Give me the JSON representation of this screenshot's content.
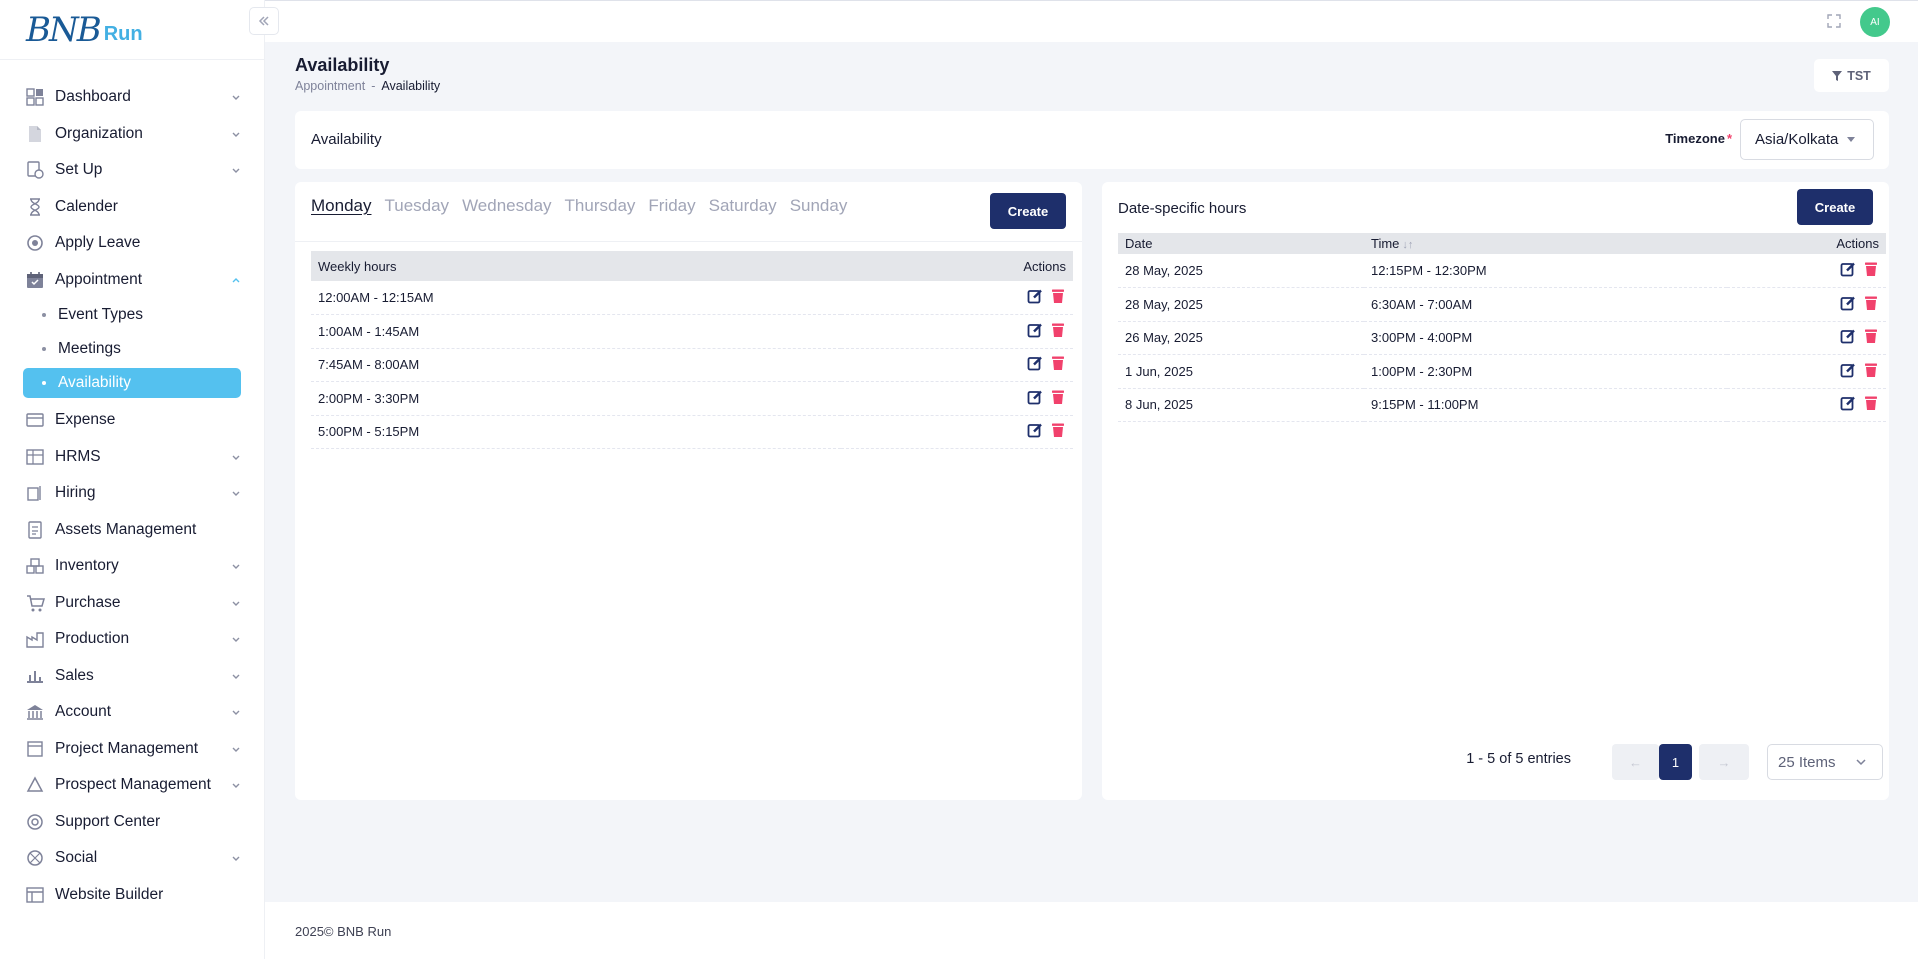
{
  "brand": {
    "logo_text": "BNB",
    "logo_suffix": "Run"
  },
  "sidebar": {
    "items": [
      {
        "label": "Dashboard",
        "icon": "dashboard-icon",
        "expandable": true
      },
      {
        "label": "Organization",
        "icon": "organization-icon",
        "expandable": true
      },
      {
        "label": "Set Up",
        "icon": "setup-icon",
        "expandable": true
      },
      {
        "label": "Calender",
        "icon": "hourglass-icon",
        "expandable": false
      },
      {
        "label": "Apply Leave",
        "icon": "leave-icon",
        "expandable": false
      },
      {
        "label": "Appointment",
        "icon": "calendar-icon",
        "expandable": true,
        "expanded": true
      },
      {
        "label": "Expense",
        "icon": "expense-icon",
        "expandable": false
      },
      {
        "label": "HRMS",
        "icon": "hrms-icon",
        "expandable": true
      },
      {
        "label": "Hiring",
        "icon": "hiring-icon",
        "expandable": true
      },
      {
        "label": "Assets Management",
        "icon": "assets-icon",
        "expandable": false
      },
      {
        "label": "Inventory",
        "icon": "inventory-icon",
        "expandable": true
      },
      {
        "label": "Purchase",
        "icon": "cart-icon",
        "expandable": true
      },
      {
        "label": "Production",
        "icon": "factory-icon",
        "expandable": true
      },
      {
        "label": "Sales",
        "icon": "sales-icon",
        "expandable": true
      },
      {
        "label": "Account",
        "icon": "bank-icon",
        "expandable": true
      },
      {
        "label": "Project Management",
        "icon": "project-icon",
        "expandable": true
      },
      {
        "label": "Prospect Management",
        "icon": "prospect-icon",
        "expandable": true
      },
      {
        "label": "Support Center",
        "icon": "support-icon",
        "expandable": false
      },
      {
        "label": "Social",
        "icon": "social-icon",
        "expandable": true
      },
      {
        "label": "Website Builder",
        "icon": "website-icon",
        "expandable": false
      }
    ],
    "appointment_sub": [
      "Event Types",
      "Meetings",
      "Availability"
    ]
  },
  "topbar": {
    "avatar_initials": "AI"
  },
  "page": {
    "title": "Availability",
    "breadcrumb": [
      "Appointment",
      "-",
      "Availability"
    ],
    "filter_label": "TST"
  },
  "availability_card": {
    "title": "Availability",
    "timezone_label": "Timezone",
    "timezone_required": "*",
    "timezone_value": "Asia/Kolkata"
  },
  "weekly": {
    "tabs": [
      "Monday",
      "Tuesday",
      "Wednesday",
      "Thursday",
      "Friday",
      "Saturday",
      "Sunday"
    ],
    "active_tab": "Monday",
    "create_label": "Create",
    "columns": [
      "Weekly hours",
      "Actions"
    ],
    "rows": [
      "12:00AM - 12:15AM",
      "1:00AM - 1:45AM",
      "7:45AM - 8:00AM",
      "2:00PM - 3:30PM",
      "5:00PM - 5:15PM"
    ]
  },
  "date_specific": {
    "title": "Date-specific hours",
    "create_label": "Create",
    "columns": [
      "Date",
      "Time",
      "Actions"
    ],
    "rows": [
      {
        "date": "28 May, 2025",
        "time": "12:15PM - 12:30PM"
      },
      {
        "date": "28 May, 2025",
        "time": "6:30AM - 7:00AM"
      },
      {
        "date": "26 May, 2025",
        "time": "3:00PM - 4:00PM"
      },
      {
        "date": "1 Jun, 2025",
        "time": "1:00PM - 2:30PM"
      },
      {
        "date": "8 Jun, 2025",
        "time": "9:15PM - 11:00PM"
      }
    ],
    "pagination": {
      "summary": "1 - 5 of 5 entries",
      "prev": "←",
      "current_page": "1",
      "next": "→",
      "per_page": "25 Items"
    }
  },
  "footer": {
    "text": "2025© BNB Run"
  },
  "colors": {
    "primary": "#1e2f6b",
    "accent": "#54c1ef",
    "danger": "#f1416c",
    "avatar": "#43c98c"
  }
}
